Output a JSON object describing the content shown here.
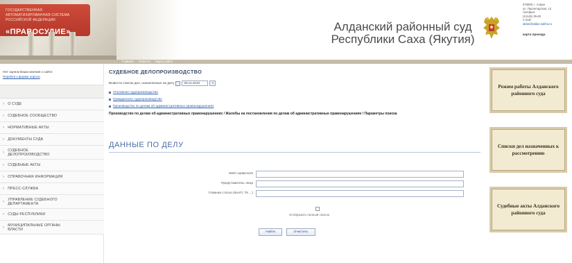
{
  "header": {
    "logo": {
      "lines": [
        "ГОСУДАРСТВЕННАЯ",
        "АВТОМАТИЗИРОВАННАЯ СИСТЕМА",
        "РОССИЙСКОЙ ФЕДЕРАЦИИ"
      ],
      "main": "«ПРАВОСУДИЕ»"
    },
    "court_title_line1": "Алданский районный суд",
    "court_title_line2": "Республики Саха (Якутия)",
    "contact_lines": [
      "678900, г. Алдан",
      "ул. Пролетарская, 12",
      "телефон:",
      "(41145) 35-60",
      "e-mail:",
      "aldan@aldan.sakha.ru"
    ],
    "map_link": "карта проезда",
    "nav_links": [
      "Главная",
      "Новости",
      "Карта сайта"
    ]
  },
  "sidebar": {
    "note": "Нет оценок Ваши мнения о сайте:",
    "note_link": "Перейти к форме опроса",
    "menu": [
      {
        "label": "О СУДЕ"
      },
      {
        "label": "СУДЕБНОЕ СООБЩЕСТВО"
      },
      {
        "label": "НОРМАТИВНЫЕ АКТЫ"
      },
      {
        "label": "ДОКУМЕНТЫ СУДА"
      },
      {
        "label": "СУДЕБНОЕ ДЕЛОПРОИЗВОДСТВО"
      },
      {
        "label": "СУДЕБНЫЕ АКТЫ"
      },
      {
        "label": "СПРАВОЧНАЯ ИНФОРМАЦИЯ"
      },
      {
        "label": "ПРЕСС-СЛУЖБА"
      },
      {
        "label": "УПРАВЛЕНИЕ СУДЕБНОГО ДЕПАРТАМЕНТА"
      },
      {
        "label": "СУДЫ РЕСПУБЛИКИ"
      },
      {
        "label": "МУНИЦИПАЛЬНЫЕ ОРГАНЫ ВЛАСТИ"
      }
    ]
  },
  "main": {
    "page_title": "СУДЕБНОЕ ДЕЛОПРОИЗВОДСТВО",
    "date_label": "Вывести список дел, назначенных на дату",
    "date_value": "09.11.2010",
    "go_label": "»",
    "links": [
      "Уголовное судопроизводство",
      "Гражданское судопроизводство",
      "Производство по делам об административных правонарушениях"
    ],
    "path_text": "Производство по делам об административных правонарушениях / Жалобы на постановления по делам об административных правонарушениях / Параметры поиска",
    "section_title": "ДАННЫЕ ПО ДЕЛУ",
    "form": {
      "fields": [
        {
          "label": "ФИО заявителя",
          "value": ""
        },
        {
          "label": "Представитель лица",
          "value": ""
        },
        {
          "label": "Главная статья (КоАП, ТК ...)",
          "value": ""
        }
      ],
      "show_full_list_label": "Отобразить полный список",
      "find_button": "Найти",
      "clear_button": "Очистить"
    }
  },
  "right_panels": [
    {
      "text": "Режим работы Алданского районного суда"
    },
    {
      "text": "Списки дел назначенных к рассмотрению"
    },
    {
      "text": "Судебные акты Алданского районного суда"
    }
  ],
  "colors": {
    "logo_red": "#c0443a",
    "link_blue": "#2a5db0",
    "title_blue": "#4a6aa5",
    "panel_beige": "#f3ead2"
  }
}
